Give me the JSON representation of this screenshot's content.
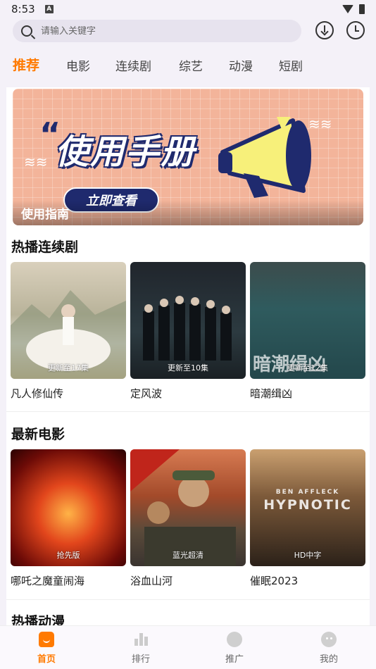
{
  "status_bar": {
    "time": "8:53"
  },
  "search": {
    "placeholder": "请输入关键字"
  },
  "tabs": [
    {
      "label": "推荐",
      "active": true
    },
    {
      "label": "电影",
      "active": false
    },
    {
      "label": "连续剧",
      "active": false
    },
    {
      "label": "综艺",
      "active": false
    },
    {
      "label": "动漫",
      "active": false
    },
    {
      "label": "短剧",
      "active": false
    }
  ],
  "banner": {
    "headline": "使用手册",
    "cta": "立即查看",
    "caption": "使用指南"
  },
  "sections": [
    {
      "title": "热播连续剧",
      "items": [
        {
          "title": "凡人修仙传",
          "badge": "更新至17集"
        },
        {
          "title": "定风波",
          "badge": "更新至10集"
        },
        {
          "title": "暗潮缉凶",
          "badge": "更新至12集",
          "poster_text": "暗潮缉凶"
        }
      ]
    },
    {
      "title": "最新电影",
      "items": [
        {
          "title": "哪吒之魔童闹海",
          "badge": "抢先版"
        },
        {
          "title": "浴血山河",
          "badge": "蓝光超清"
        },
        {
          "title": "催眠2023",
          "badge": "HD中字",
          "poster_text": "HYPNOTIC",
          "poster_subtext": "BEN AFFLECK"
        }
      ]
    },
    {
      "title": "热播动漫"
    }
  ],
  "bottom_nav": [
    {
      "label": "首页",
      "active": true
    },
    {
      "label": "排行",
      "active": false
    },
    {
      "label": "推广",
      "active": false
    },
    {
      "label": "我的",
      "active": false
    }
  ],
  "colors": {
    "accent": "#ff7a00",
    "background": "#f4f1f8",
    "banner_navy": "#1f2a6e"
  }
}
